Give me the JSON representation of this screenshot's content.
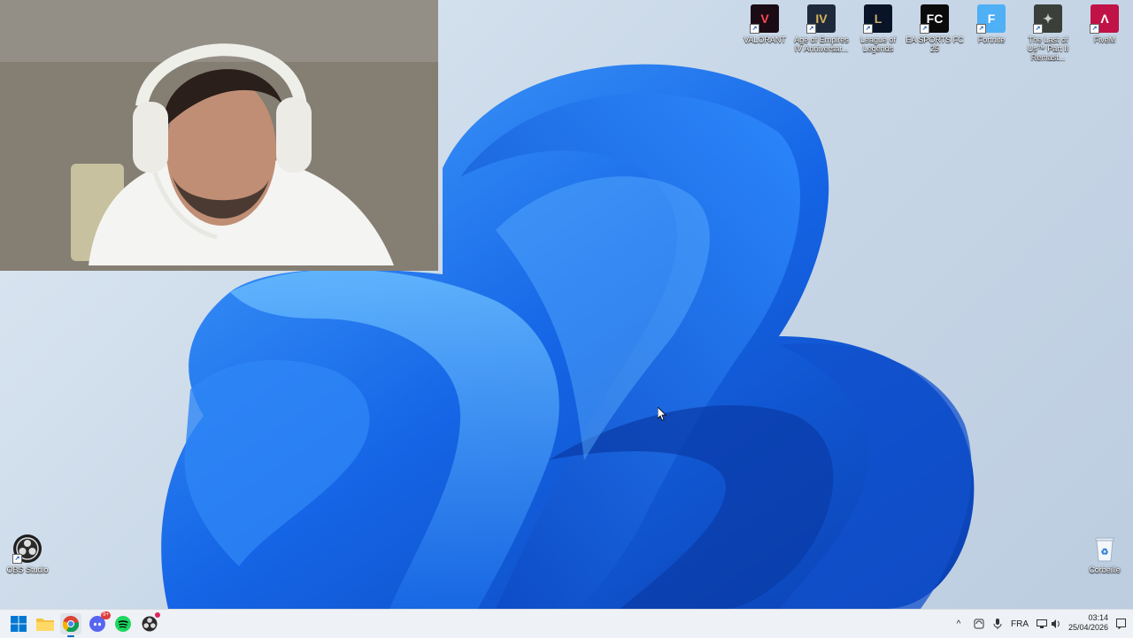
{
  "desktop": {
    "icons_top": [
      {
        "label": "VALORANT",
        "icon": "valorant-icon",
        "color": "#1b0b14",
        "accent": "#ff4655"
      },
      {
        "label": "Age of Empires IV Anniversar...",
        "icon": "age-of-empires-icon",
        "color": "#1e2a3c",
        "accent": "#d9b35a"
      },
      {
        "label": "League of Legends",
        "icon": "league-of-legends-icon",
        "color": "#0a1428",
        "accent": "#c8aa6e"
      },
      {
        "label": "EA SPORTS FC 25",
        "icon": "ea-sports-fc-icon",
        "color": "#0b0b0b",
        "accent": "#ffffff"
      },
      {
        "label": "Fortnite",
        "icon": "fortnite-icon",
        "color": "#4fb0f5",
        "accent": "#ffffff"
      },
      {
        "label": "The Last of Us™ Part II Remast...",
        "icon": "the-last-of-us-icon",
        "color": "#3a3f3a",
        "accent": "#c9cfc6"
      },
      {
        "label": "FiveM",
        "icon": "fivem-icon",
        "color": "#c01246",
        "accent": "#ffffff"
      }
    ],
    "obs": {
      "label": "OBS Studio",
      "icon": "obs-studio-icon"
    },
    "recycle": {
      "label": "Corbeille",
      "icon": "recycle-bin-icon"
    }
  },
  "taskbar": {
    "apps": [
      {
        "name": "start-button",
        "icon": "windows-logo-icon"
      },
      {
        "name": "file-explorer-button",
        "icon": "folder-icon"
      },
      {
        "name": "chrome-button",
        "icon": "chrome-icon"
      },
      {
        "name": "discord-button",
        "icon": "discord-icon",
        "badge": "9+"
      },
      {
        "name": "spotify-button",
        "icon": "spotify-icon"
      },
      {
        "name": "obs-taskbar-button",
        "icon": "obs-studio-icon"
      }
    ],
    "tray": {
      "language": "FRA",
      "time": "03:14",
      "date": "25/04/2026"
    }
  },
  "colors": {
    "wallpaper_blue": "#1669e0",
    "taskbar_bg": "#eef1f5",
    "accent": "#0067c0"
  }
}
